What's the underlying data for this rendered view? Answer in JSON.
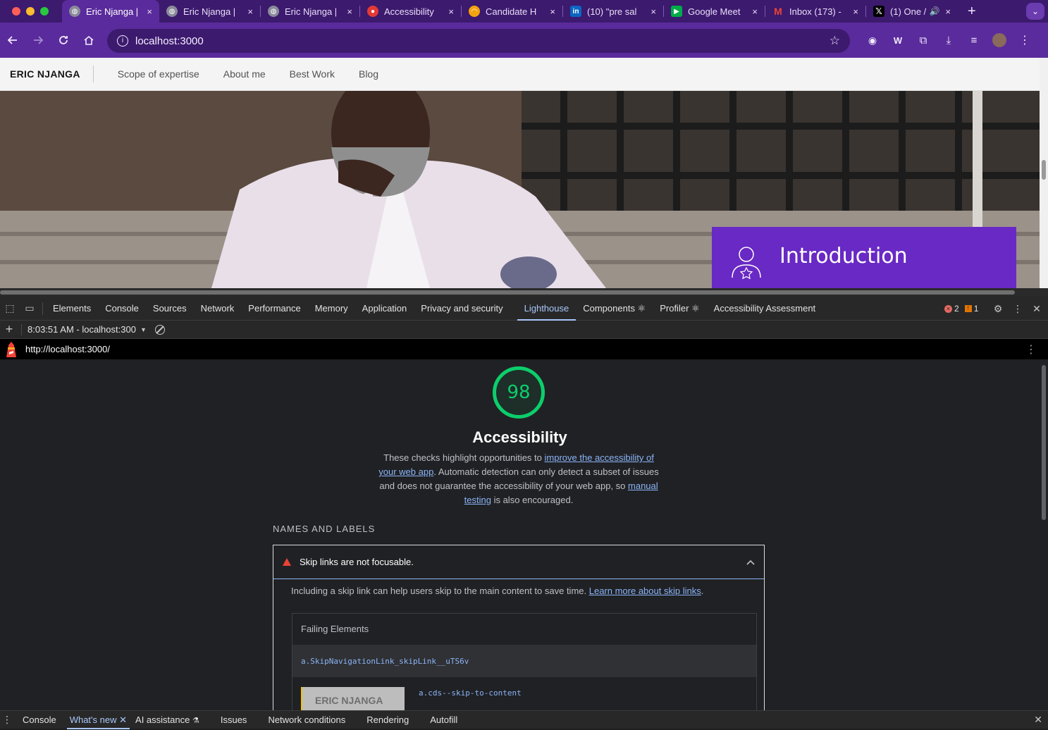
{
  "browser": {
    "tabs": [
      {
        "title": "Eric Njanga |",
        "active": true
      },
      {
        "title": "Eric Njanga |",
        "active": false
      },
      {
        "title": "Eric Njanga |",
        "active": false
      },
      {
        "title": "Accessibility",
        "active": false
      },
      {
        "title": "Candidate H",
        "active": false
      },
      {
        "title": "(10) \"pre sal",
        "active": false
      },
      {
        "title": "Google Meet",
        "active": false
      },
      {
        "title": "Inbox (173) -",
        "active": false
      },
      {
        "title": "(1) One /",
        "active": false
      }
    ],
    "close_glyph": "×",
    "new_tab_glyph": "+",
    "url": "localhost:3000"
  },
  "site": {
    "brand": "ERIC NJANGA",
    "nav": [
      "Scope of expertise",
      "About me",
      "Best Work",
      "Blog"
    ],
    "intro_title": "Introduction"
  },
  "devtools": {
    "tabs": [
      "Elements",
      "Console",
      "Sources",
      "Network",
      "Performance",
      "Memory",
      "Application",
      "Privacy and security",
      "Lighthouse",
      "Components ⚛",
      "Profiler ⚛",
      "Accessibility Assessment"
    ],
    "active_tab": "Lighthouse",
    "errors": "2",
    "warnings": "1",
    "report_selector": "8:03:51 AM - localhost:300",
    "report_url": "http://localhost:3000/"
  },
  "lighthouse": {
    "score": "98",
    "category": "Accessibility",
    "desc_1": "These checks highlight opportunities to ",
    "desc_link_1": "improve the accessibility of your web app",
    "desc_2": ". Automatic detection can only detect a subset of issues and does not guarantee the accessibility of your web app, so ",
    "desc_link_2": "manual testing",
    "desc_3": " is also encouraged.",
    "group": "NAMES AND LABELS",
    "audit_title": "Skip links are not focusable.",
    "audit_desc": "Including a skip link can help users skip to the main content to save time. ",
    "audit_link": "Learn more about skip links",
    "audit_desc_end": ".",
    "failing_header": "Failing Elements",
    "failing": [
      "a.SkipNavigationLink_skipLink__uTS6v",
      "a.cds--skip-to-content"
    ],
    "thumb_text": "ERIC NJANGA"
  },
  "drawer": {
    "tabs": [
      "Console",
      "What's new",
      "AI assistance",
      "Issues",
      "Network conditions",
      "Rendering",
      "Autofill"
    ],
    "active_tab": "What's new"
  },
  "colors": {
    "tab_strip": "#3c1a6e",
    "toolbar": "#5a2b9c",
    "score_green": "#0cce6b",
    "intro_purple": "#6929c4"
  }
}
